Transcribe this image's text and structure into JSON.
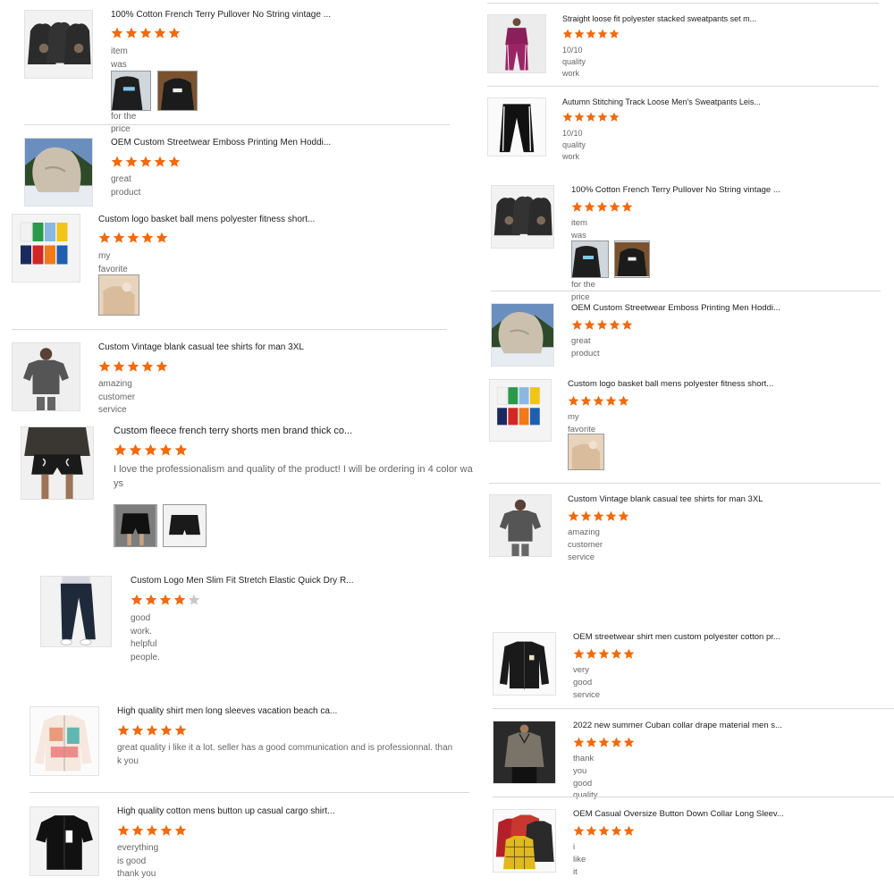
{
  "colors": {
    "star": "#f06a0f",
    "star_empty": "#c9c9c9",
    "divider": "#d8d8d8"
  },
  "left": {
    "reviews": [
      {
        "title": "100% Cotton French Terry Pullover No String vintage ...",
        "rating": 5,
        "comment": "item was very high quality for the price",
        "thumb_icon": "hoodie-group-icon",
        "photos": 2
      },
      {
        "title": "OEM Custom Streetwear Emboss Printing Men Hoddi...",
        "rating": 5,
        "comment": "great product",
        "thumb_icon": "hoodie-photo-icon",
        "photos": 0
      },
      {
        "title": "Custom logo basket ball mens polyester fitness short...",
        "rating": 5,
        "comment": "my favorite company to work with",
        "thumb_icon": "shorts-grid-icon",
        "photos": 1
      },
      {
        "title": "Custom Vintage blank casual tee shirts for man 3XL",
        "rating": 5,
        "comment": "amazing customer service",
        "thumb_icon": "tee-model-icon",
        "photos": 0
      },
      {
        "title": "Custom fleece french terry shorts men brand thick co...",
        "rating": 5,
        "comment": "I love the professionalism and quality of the product! I will be ordering in 4 color ways",
        "thumb_icon": "shorts-model-icon",
        "photos": 2
      },
      {
        "title": "Custom Logo Men Slim Fit Stretch Elastic Quick Dry R...",
        "rating": 4,
        "comment": "good work. helpful people.",
        "thumb_icon": "joggers-model-icon",
        "photos": 0
      },
      {
        "title": "High quality shirt men long sleeves vacation beach ca...",
        "rating": 5,
        "comment": "great quality i like it a lot. seller has a good communication and is professionnal. thank you",
        "thumb_icon": "printed-shirt-icon",
        "photos": 0
      },
      {
        "title": "High quality cotton mens button up casual cargo shirt...",
        "rating": 5,
        "comment": "everything is good thank you",
        "thumb_icon": "black-shirt-icon",
        "photos": 0
      }
    ]
  },
  "right": {
    "reviews": [
      {
        "title": "Straight loose fit polyester stacked sweatpants set m...",
        "rating": 5,
        "comment": "10/10 quality work",
        "thumb_icon": "tracksuit-model-icon",
        "photos": 0
      },
      {
        "title": "Autumn Stitching Track Loose Men's Sweatpants Leis...",
        "rating": 5,
        "comment": "10/10 quality work",
        "thumb_icon": "sweatpants-icon",
        "photos": 0
      },
      {
        "title": "100% Cotton French Terry Pullover No String vintage ...",
        "rating": 5,
        "comment": "item was very high quality for the price",
        "thumb_icon": "hoodie-group-icon",
        "photos": 2
      },
      {
        "title": "OEM Custom Streetwear Emboss Printing Men Hoddi...",
        "rating": 5,
        "comment": "great product",
        "thumb_icon": "hoodie-photo-icon",
        "photos": 0
      },
      {
        "title": "Custom logo basket ball mens polyester fitness short...",
        "rating": 5,
        "comment": "my favorite company to work with",
        "thumb_icon": "shorts-grid-icon",
        "photos": 1
      },
      {
        "title": "Custom Vintage blank casual tee shirts for man 3XL",
        "rating": 5,
        "comment": "amazing customer service",
        "thumb_icon": "tee-model-icon",
        "photos": 0
      },
      {
        "title": "OEM streetwear shirt men custom polyester cotton pr...",
        "rating": 5,
        "comment": "very good service",
        "thumb_icon": "jacket-icon",
        "photos": 0
      },
      {
        "title": "2022 new summer Cuban collar drape material men s...",
        "rating": 5,
        "comment": "thank you good quality",
        "thumb_icon": "cuban-shirt-model-icon",
        "photos": 0
      },
      {
        "title": "OEM Casual Oversize Button Down Collar Long Sleev...",
        "rating": 5,
        "comment": "i like it",
        "thumb_icon": "flannel-shirts-icon",
        "photos": 0
      }
    ]
  }
}
